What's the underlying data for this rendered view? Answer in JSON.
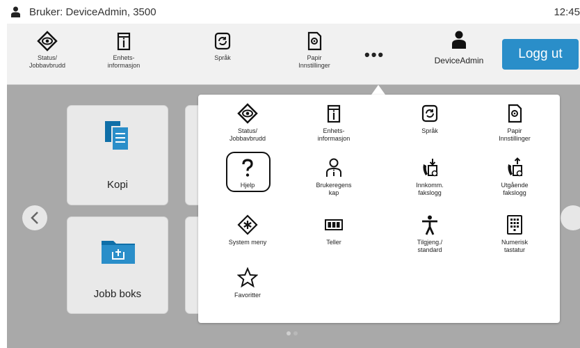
{
  "status_bar": {
    "user_label": "Bruker: DeviceAdmin, 3500",
    "clock": "12:45"
  },
  "toolbar": {
    "items": [
      {
        "label": "Status/\nJobbavbrudd",
        "icon": "eye-diamond-icon"
      },
      {
        "label": "Enhets-\ninformasjon",
        "icon": "device-info-icon"
      },
      {
        "label": "Språk",
        "icon": "language-icon"
      },
      {
        "label": "Papir\nInnstillinger",
        "icon": "paper-settings-icon"
      }
    ],
    "more_label": "•••",
    "user_name": "DeviceAdmin",
    "logout_label": "Logg ut"
  },
  "home": {
    "tiles": [
      {
        "label": "Kopi"
      },
      {
        "label": "Jobb boks"
      }
    ],
    "page_indicator": {
      "total": 2,
      "current": 1
    }
  },
  "popup": {
    "items": [
      {
        "label": "Status/\nJobbavbrudd",
        "icon": "eye-diamond-icon"
      },
      {
        "label": "Enhets-\ninformasjon",
        "icon": "device-info-icon"
      },
      {
        "label": "Språk",
        "icon": "language-icon"
      },
      {
        "label": "Papir\nInnstillinger",
        "icon": "paper-settings-icon"
      },
      {
        "label": "Hjelp",
        "icon": "help-icon"
      },
      {
        "label": "Brukeregens\nkap",
        "icon": "user-properties-icon"
      },
      {
        "label": "Innkomm.\nfakslogg",
        "icon": "fax-incoming-log-icon"
      },
      {
        "label": "Utgående\nfakslogg",
        "icon": "fax-outgoing-log-icon"
      },
      {
        "label": "System meny",
        "icon": "system-menu-icon"
      },
      {
        "label": "Teller",
        "icon": "counter-icon"
      },
      {
        "label": "Tilgjeng./\nstandard",
        "icon": "accessibility-icon"
      },
      {
        "label": "Numerisk\ntastatur",
        "icon": "numeric-keypad-icon"
      },
      {
        "label": "Favoritter",
        "icon": "star-icon"
      }
    ]
  },
  "colors": {
    "accent": "#2a8ec9",
    "background": "#a9a9a9",
    "panel": "#ffffff"
  }
}
